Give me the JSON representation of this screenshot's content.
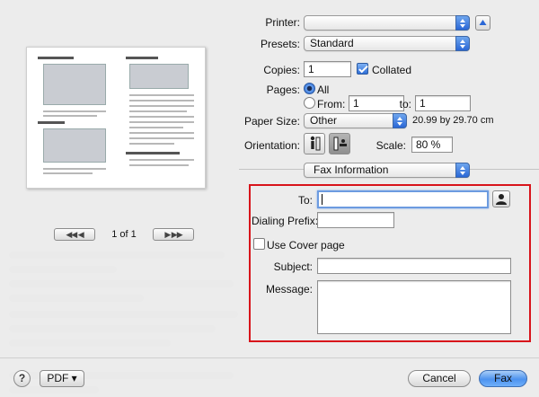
{
  "settings": {
    "printer_label": "Printer:",
    "printer_value": "",
    "presets_label": "Presets:",
    "presets_value": "Standard",
    "copies_label": "Copies:",
    "copies_value": "1",
    "collated_label": "Collated",
    "collated_checked": true,
    "pages_label": "Pages:",
    "pages_all_label": "All",
    "pages_from_label": "From:",
    "pages_from_value": "1",
    "pages_to_label": "to:",
    "pages_to_value": "1",
    "paper_size_label": "Paper Size:",
    "paper_size_value": "Other",
    "paper_size_dims": "20.99 by 29.70 cm",
    "orientation_label": "Orientation:",
    "scale_label": "Scale:",
    "scale_value": "80 %",
    "panel_popup_value": "Fax Information"
  },
  "fax": {
    "to_label": "To:",
    "to_value": "",
    "dialing_prefix_label": "Dialing Prefix:",
    "dialing_prefix_value": "",
    "cover_page_label": "Use Cover page",
    "cover_page_checked": false,
    "subject_label": "Subject:",
    "subject_value": "",
    "message_label": "Message:",
    "message_value": ""
  },
  "preview": {
    "page_indicator": "1 of 1",
    "first_label": "◀◀",
    "prev_label": "◀",
    "next_label": "▶",
    "last_label": "▶▶"
  },
  "footer": {
    "help_label": "?",
    "pdf_label": "PDF ▾",
    "cancel_label": "Cancel",
    "fax_label": "Fax"
  },
  "colors": {
    "highlight_box": "#d8141b",
    "accent": "#2a67d6"
  }
}
